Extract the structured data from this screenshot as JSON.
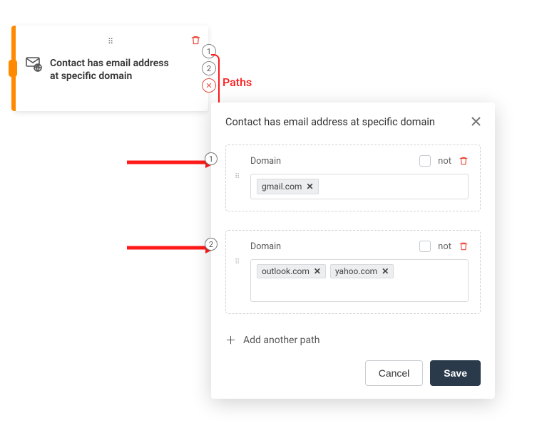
{
  "node": {
    "title": "Contact has email address at specific domain",
    "paths": [
      "1",
      "2"
    ],
    "extraBadge": "✕"
  },
  "annotation": {
    "pathsLabel": "Paths"
  },
  "panel": {
    "title": "Contact has email address at specific domain",
    "paths": [
      {
        "num": "1",
        "fieldLabel": "Domain",
        "notLabel": "not",
        "domains": [
          "gmail.com"
        ]
      },
      {
        "num": "2",
        "fieldLabel": "Domain",
        "notLabel": "not",
        "domains": [
          "outlook.com",
          "yahoo.com"
        ]
      }
    ],
    "addPathLabel": "Add another path",
    "cancelLabel": "Cancel",
    "saveLabel": "Save"
  }
}
